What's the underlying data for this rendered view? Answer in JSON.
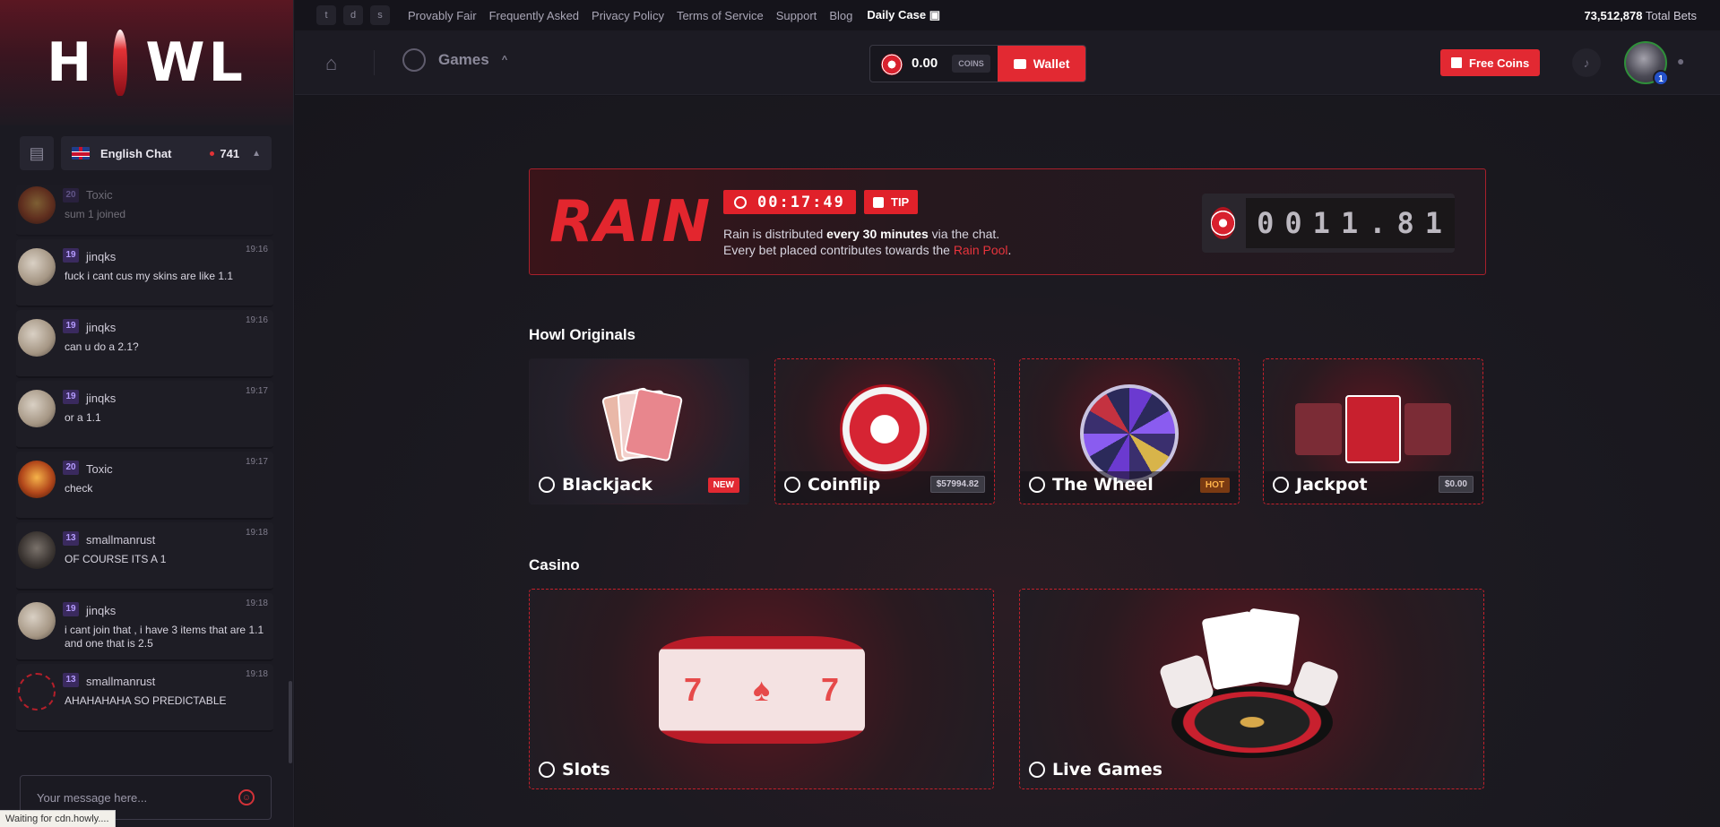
{
  "sidebar": {
    "logo": {
      "left": "H",
      "right": "WL"
    },
    "chat": {
      "room": "English Chat",
      "online": "741",
      "messages": [
        {
          "level": "20",
          "user": "Toxic",
          "time": "",
          "text": "sum 1 joined",
          "avatar": "toxic"
        },
        {
          "level": "19",
          "user": "jinqks",
          "time": "19:16",
          "text": "fuck i cant cus my skins are like 1.1",
          "avatar": "jinqks"
        },
        {
          "level": "19",
          "user": "jinqks",
          "time": "19:16",
          "text": "can u do a 2.1?",
          "avatar": "jinqks"
        },
        {
          "level": "19",
          "user": "jinqks",
          "time": "19:17",
          "text": "or a 1.1",
          "avatar": "jinqks"
        },
        {
          "level": "20",
          "user": "Toxic",
          "time": "19:17",
          "text": "check",
          "avatar": "toxic"
        },
        {
          "level": "13",
          "user": "smallmanrust",
          "time": "19:18",
          "text": "OF COURSE ITS A 1",
          "avatar": "smallman"
        },
        {
          "level": "19",
          "user": "jinqks",
          "time": "19:18",
          "text": "i cant join that , i have 3 items that are 1.1 and one that is 2.5",
          "avatar": "jinqks"
        },
        {
          "level": "13",
          "user": "smallmanrust",
          "time": "19:18",
          "text": "AHAHAHAHA SO PREDICTABLE",
          "avatar": "ring"
        }
      ],
      "input_placeholder": "Your message here..."
    },
    "status": "Waiting for cdn.howly...."
  },
  "topbar": {
    "links": [
      "Provably Fair",
      "Frequently Asked",
      "Privacy Policy",
      "Terms of Service",
      "Support",
      "Blog"
    ],
    "daily_case": "Daily Case",
    "total_bets_value": "73,512,878",
    "total_bets_label": "Total Bets"
  },
  "header": {
    "games_label": "Games",
    "balance": "0.00",
    "balance_unit": "COINS",
    "wallet_label": "Wallet",
    "free_coins_label": "Free Coins",
    "notification_badge": "1"
  },
  "rain": {
    "title": "RAIN",
    "timer": "00:17:49",
    "tip_label": "TIP",
    "desc_line1_pre": "Rain is distributed ",
    "desc_line1_bold": "every 30 minutes",
    "desc_line1_post": " via the chat.",
    "desc_line2_pre": "Every bet placed contributes towards the ",
    "desc_line2_link": "Rain Pool",
    "desc_line2_post": ".",
    "pool_digits": [
      "0",
      "0",
      "1",
      "1",
      ".",
      "8",
      "1"
    ]
  },
  "originals": {
    "title": "Howl Originals",
    "cards": [
      {
        "label": "Blackjack",
        "tag": "NEW"
      },
      {
        "label": "Coinflip",
        "tag": "$57994.82"
      },
      {
        "label": "The Wheel",
        "tag": "HOT"
      },
      {
        "label": "Jackpot",
        "tag": "$0.00"
      }
    ]
  },
  "casino": {
    "title": "Casino",
    "cards": [
      {
        "label": "Slots"
      },
      {
        "label": "Live Games"
      }
    ]
  },
  "colors": {
    "accent": "#e22932",
    "bg": "#16151c",
    "sidebar": "#1b1a22"
  },
  "icons": [
    "twitter-icon",
    "discord-icon",
    "steam-icon",
    "home-icon",
    "games-icon",
    "bell-icon",
    "user-icon",
    "emoji-icon"
  ]
}
